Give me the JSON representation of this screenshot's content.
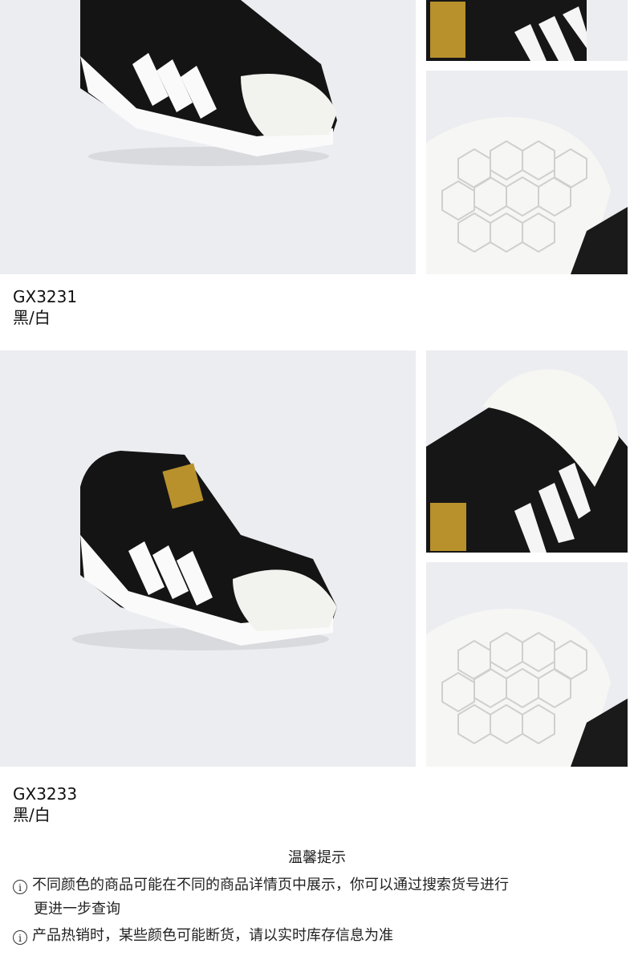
{
  "products": [
    {
      "code": "GX3231",
      "color": "黑/白"
    },
    {
      "code": "GX3233",
      "color": "黑/白"
    }
  ],
  "notice": {
    "title": "温馨提示",
    "items": [
      {
        "icon": "info-circle-icon",
        "line1": "不同颜色的商品可能在不同的商品详情页中展示，你可以通过搜索货号进行",
        "line2": "更进一步查询"
      },
      {
        "icon": "info-circle-icon",
        "line1": "产品热销时，某些颜色可能断货，请以实时库存信息为准"
      }
    ]
  }
}
